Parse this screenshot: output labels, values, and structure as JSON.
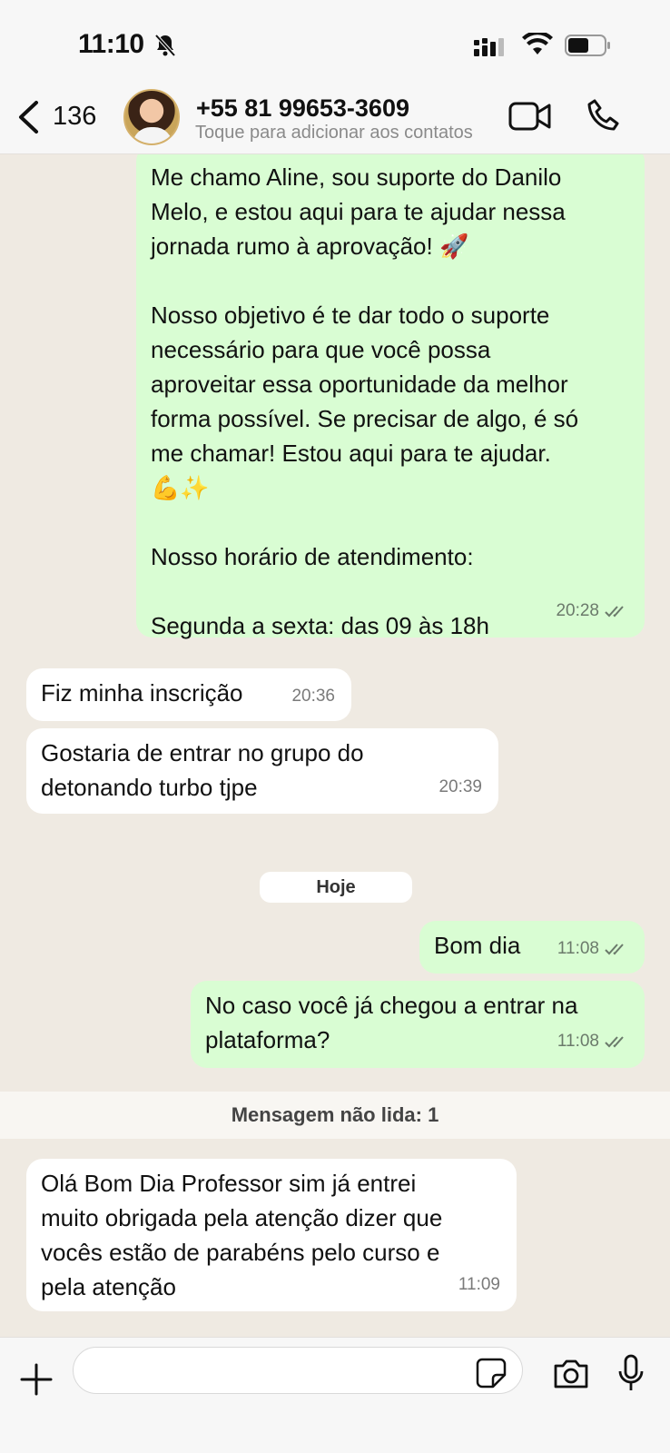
{
  "status_bar": {
    "time": "11:10"
  },
  "header": {
    "back_count": "136",
    "contact_name": "+55 81 99653-3609",
    "contact_subtitle": "Toque para adicionar aos contatos",
    "icons": [
      "back-chevron-icon",
      "video-call-icon",
      "phone-call-icon"
    ]
  },
  "messages": [
    {
      "direction": "out",
      "text": "Me chamo Aline, sou suporte do Danilo\nMelo, e estou aqui para te ajudar nessa\njornada rumo à aprovação! 🚀\n\nNosso objetivo é te dar todo o suporte\nnecessário para que você possa\naproveitar essa oportunidade da melhor\nforma possível. Se precisar de algo, é só\nme chamar! Estou aqui para te ajudar.\n💪✨\n\nNosso horário de atendimento:\n\nSegunda a sexta: das 09 às 18h",
      "time": "20:28"
    },
    {
      "direction": "in",
      "text": "Fiz minha inscrição",
      "time": "20:36"
    },
    {
      "direction": "in",
      "text": "Gostaria de entrar no grupo do\ndetonando turbo tjpe",
      "time": "20:39"
    },
    {
      "direction": "out",
      "text": "Bom dia",
      "time": "11:08"
    },
    {
      "direction": "out",
      "text": "No caso você já chegou a entrar na\nplataforma?",
      "time": "11:08"
    },
    {
      "direction": "in",
      "text": "Olá Bom Dia Professor sim já entrei\nmuito obrigada pela atenção dizer que\nvocês estão de parabéns pelo curso e\npela atenção",
      "time": "11:09"
    }
  ],
  "day_separator": "Hoje",
  "unread_label": "Mensagem não lida: 1",
  "composer": {
    "placeholder": ""
  },
  "colors": {
    "outgoing": "#d9fdd3",
    "incoming": "#ffffff",
    "background": "#efeae2",
    "read_ticks": "#6b7a6b"
  }
}
